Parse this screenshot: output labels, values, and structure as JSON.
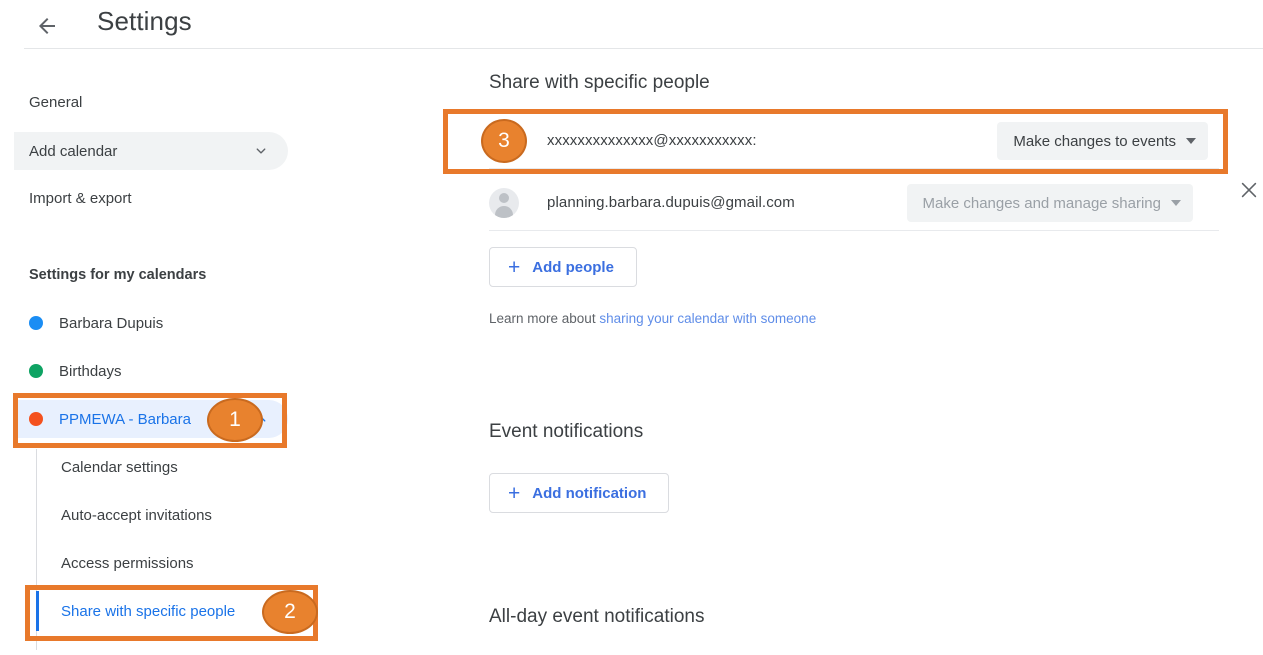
{
  "header": {
    "back_icon": "back-arrow-icon",
    "title": "Settings"
  },
  "sidebar": {
    "nav": [
      {
        "label": "General",
        "icon": null
      },
      {
        "label": "Add calendar",
        "icon": "chevron-down-icon"
      },
      {
        "label": "Import & export",
        "icon": null
      }
    ],
    "calendars_section_label": "Settings for my calendars",
    "calendars": [
      {
        "label": "Barbara Dupuis",
        "color": "#1a8df4"
      },
      {
        "label": "Birthdays",
        "color": "#0ea363"
      },
      {
        "label": "PPMEWA - Barbara",
        "color": "#f4511e",
        "selected": true,
        "icon": "chevron-up-icon"
      }
    ],
    "sub_items": [
      {
        "label": "Calendar settings",
        "selected": false
      },
      {
        "label": "Auto-accept invitations",
        "selected": false
      },
      {
        "label": "Access permissions",
        "selected": false
      },
      {
        "label": "Share with specific people",
        "selected": true
      }
    ]
  },
  "main": {
    "share_heading": "Share with specific people",
    "share_rows": [
      {
        "email": "xxxxxxxxxxxxxx@xxxxxxxxxxx:",
        "permission": "Make changes to events",
        "disabled": false,
        "has_avatar": false,
        "has_close": true,
        "close_icon": "close-icon"
      },
      {
        "email": "planning.barbara.dupuis@gmail.com",
        "permission": "Make changes and manage sharing",
        "disabled": true,
        "has_avatar": true,
        "has_close": false
      }
    ],
    "add_people_label": "Add people",
    "add_people_plus": "+",
    "learn_more_prefix": "Learn more about ",
    "learn_more_link": "sharing your calendar with someone",
    "event_notifications_heading": "Event notifications",
    "add_notification_label": "Add notification",
    "add_notification_plus": "+",
    "allday_notifications_heading": "All-day event notifications"
  },
  "annotations": {
    "accent_color": "#e8792b",
    "badge_fill": "#e8822e",
    "badge_border": "#c96a1f",
    "badges": [
      {
        "number": "1",
        "target": "PPMEWA - Barbara"
      },
      {
        "number": "2",
        "target": "Share with specific people"
      },
      {
        "number": "3",
        "target": "share row email"
      }
    ]
  }
}
